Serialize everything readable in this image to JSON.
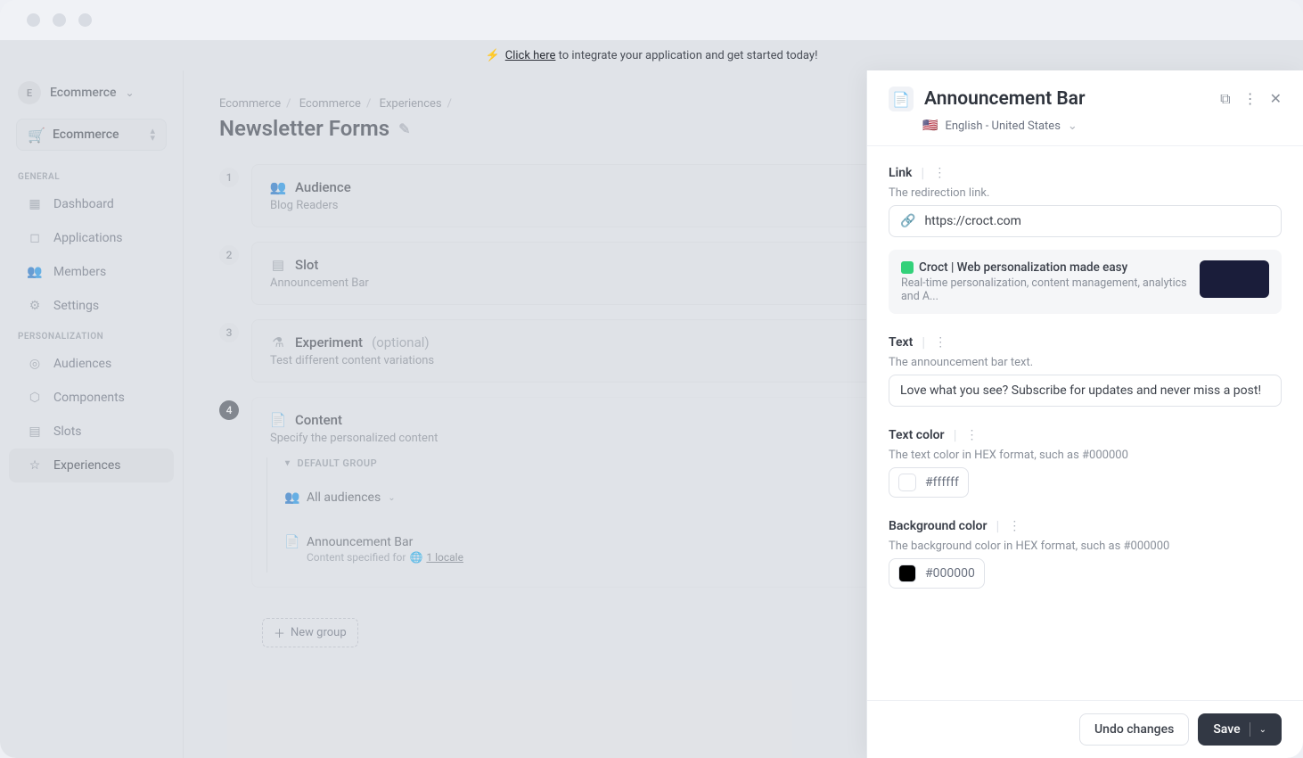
{
  "banner": {
    "prefix": "Click here",
    "suffix": " to integrate your application and get started today!"
  },
  "workspace": {
    "initial": "E",
    "name": "Ecommerce",
    "switcher_label": "Ecommerce"
  },
  "sidebar": {
    "section_general": "GENERAL",
    "section_personalization": "PERSONALIZATION",
    "items": {
      "dashboard": "Dashboard",
      "applications": "Applications",
      "members": "Members",
      "settings": "Settings",
      "audiences": "Audiences",
      "components": "Components",
      "slots": "Slots",
      "experiences": "Experiences"
    }
  },
  "breadcrumb": {
    "a": "Ecommerce",
    "b": "Ecommerce",
    "c": "Experiences"
  },
  "page_title": "Newsletter Forms",
  "steps": {
    "audience": {
      "num": "1",
      "title": "Audience",
      "sub": "Blog Readers"
    },
    "slot": {
      "num": "2",
      "title": "Slot",
      "sub": "Announcement Bar"
    },
    "experiment": {
      "num": "3",
      "title": "Experiment",
      "opt": "(optional)",
      "sub": "Test different content variations"
    },
    "content": {
      "num": "4",
      "title": "Content",
      "sub": "Specify the personalized content"
    }
  },
  "content_group": {
    "label": "DEFAULT GROUP",
    "all_audiences": "All audiences",
    "bar_title": "Announcement Bar",
    "bar_meta_prefix": "Content specified for ",
    "bar_meta_link": "1 locale"
  },
  "new_group": "New group",
  "panel": {
    "title": "Announcement Bar",
    "locale": "English - United States",
    "link": {
      "label": "Link",
      "desc": "The redirection link.",
      "value": "https://croct.com",
      "preview_title": "Croct | Web personalization made easy",
      "preview_sub": "Real-time personalization, content management, analytics and A..."
    },
    "text": {
      "label": "Text",
      "desc": "The announcement bar text.",
      "value": "Love what you see? Subscribe for updates and never miss a post!"
    },
    "text_color": {
      "label": "Text color",
      "desc": "The text color in HEX format, such as #000000",
      "value": "#ffffff",
      "swatch": "#ffffff"
    },
    "bg_color": {
      "label": "Background color",
      "desc": "The background color in HEX format, such as #000000",
      "value": "#000000",
      "swatch": "#000000"
    }
  },
  "footer": {
    "undo": "Undo changes",
    "save": "Save"
  }
}
